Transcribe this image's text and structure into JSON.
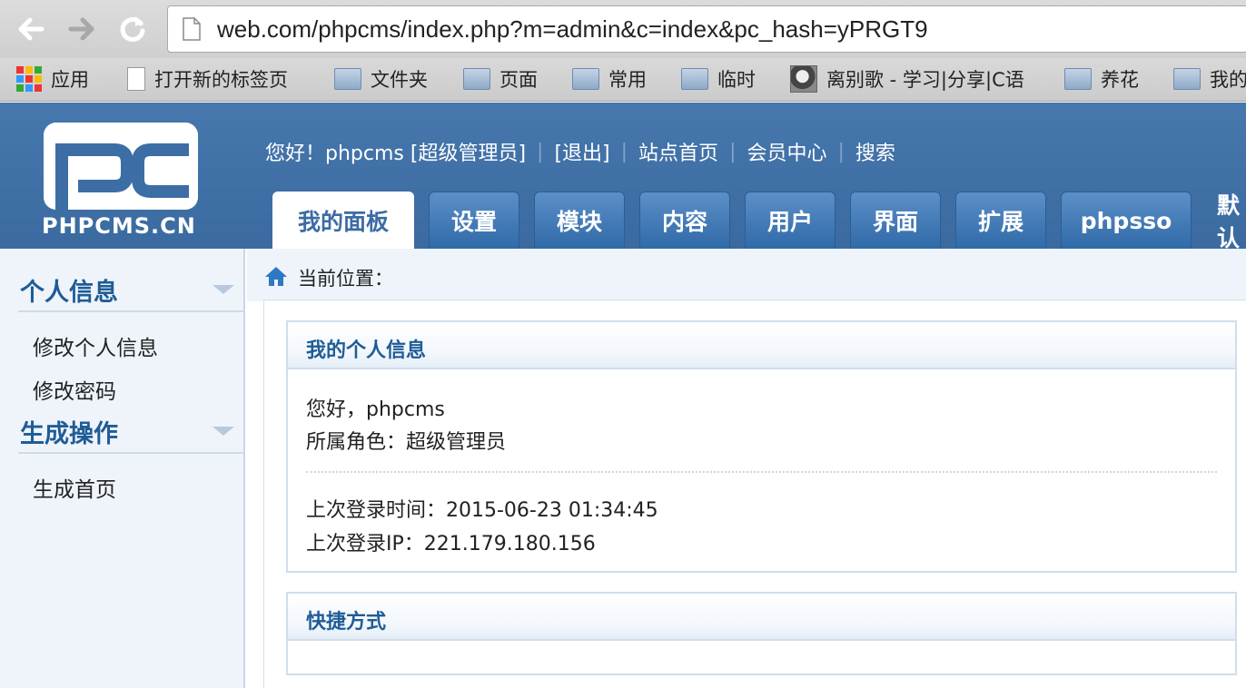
{
  "browser": {
    "url": "web.com/phpcms/index.php?m=admin&c=index&pc_hash=yPRGT9",
    "bookmarks": [
      {
        "label": "应用",
        "icon": "apps-icon"
      },
      {
        "label": "打开新的标签页",
        "icon": "page-icon"
      },
      {
        "label": "文件夹",
        "icon": "folder-icon"
      },
      {
        "label": "页面",
        "icon": "folder-icon"
      },
      {
        "label": "常用",
        "icon": "folder-icon"
      },
      {
        "label": "临时",
        "icon": "folder-icon"
      },
      {
        "label": "离别歌 - 学习|分享|C语",
        "icon": "avatar-icon"
      },
      {
        "label": "养花",
        "icon": "folder-icon"
      },
      {
        "label": "我的",
        "icon": "folder-icon"
      }
    ]
  },
  "header": {
    "logo_text": "PHPCMS.CN",
    "greeting": "您好！phpcms [超级管理员]",
    "links": [
      "[退出]",
      "站点首页",
      "会员中心",
      "搜索"
    ],
    "tabs": [
      {
        "label": "我的面板",
        "active": true
      },
      {
        "label": "设置"
      },
      {
        "label": "模块"
      },
      {
        "label": "内容"
      },
      {
        "label": "用户"
      },
      {
        "label": "界面"
      },
      {
        "label": "扩展"
      },
      {
        "label": "phpsso"
      },
      {
        "label": "默认"
      }
    ]
  },
  "sidebar": {
    "sections": [
      {
        "title": "个人信息",
        "items": [
          "修改个人信息",
          "修改密码"
        ]
      },
      {
        "title": "生成操作",
        "items": [
          "生成首页"
        ]
      }
    ]
  },
  "main": {
    "breadcrumb": "当前位置：",
    "info_panel": {
      "title": "我的个人信息",
      "hello": "您好，phpcms",
      "role": "所属角色：超级管理员",
      "last_login_time": "上次登录时间：2015-06-23 01:34:45",
      "last_login_ip": "上次登录IP：221.179.180.156"
    },
    "shortcut_panel": {
      "title": "快捷方式"
    }
  },
  "colors": {
    "header_blue": "#3c6ea5",
    "title_blue": "#1f5c96",
    "sidebar_bg": "#eef4fa"
  }
}
